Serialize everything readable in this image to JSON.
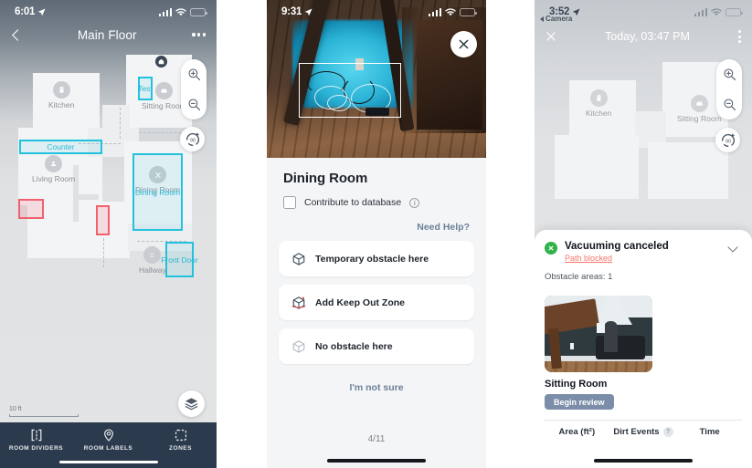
{
  "panel1": {
    "status": {
      "time": "6:01",
      "location_icon": "location-arrow-icon",
      "battery_icon": "battery-icon",
      "wifi_icon": "wifi-icon",
      "signal_icon": "cellular-bars-icon"
    },
    "nav": {
      "back_icon": "chevron-left-icon",
      "title": "Main Floor",
      "more_icon": "more-horizontal-icon"
    },
    "controls": {
      "zoom_in_icon": "zoom-in-icon",
      "zoom_out_icon": "zoom-out-icon",
      "rotate_label": "90",
      "rotate_icon": "rotate-90-icon",
      "layers_icon": "layers-icon"
    },
    "scale": {
      "label": "10 ft"
    },
    "map": {
      "rooms": [
        {
          "name": "Kitchen",
          "icon": "fridge-icon"
        },
        {
          "name": "Sitting Room",
          "icon": "sofa-icon"
        },
        {
          "name": "Living Room",
          "icon": "armchair-icon"
        },
        {
          "name": "Dining Room",
          "icon": "cutlery-icon"
        },
        {
          "name": "Hallway",
          "icon": "hallway-icon"
        }
      ],
      "zones": [
        {
          "name": "Test"
        },
        {
          "name": "Counter"
        },
        {
          "name": "Dining Room"
        },
        {
          "name": "Front Door"
        }
      ],
      "keep_out_zones": 2,
      "dock_icon": "dock-icon"
    },
    "tabs": [
      {
        "label": "ROOM DIVIDERS",
        "icon": "room-dividers-icon"
      },
      {
        "label": "ROOM LABELS",
        "icon": "map-pin-icon"
      },
      {
        "label": "ZONES",
        "icon": "dashed-square-icon"
      }
    ]
  },
  "panel2": {
    "status": {
      "time": "9:31",
      "location_icon": "location-arrow-icon",
      "battery_icon": "battery-icon",
      "wifi_icon": "wifi-icon",
      "signal_icon": "cellular-bars-icon"
    },
    "close_icon": "close-icon",
    "title": "Dining Room",
    "checkbox": {
      "label": "Contribute to database",
      "info_icon": "info-icon",
      "checked": false
    },
    "need_help": "Need Help?",
    "options": [
      {
        "label": "Temporary obstacle here",
        "icon": "cube-icon"
      },
      {
        "label": "Add Keep Out Zone",
        "icon": "cube-keepout-icon"
      },
      {
        "label": "No obstacle here",
        "icon": "cube-outline-icon"
      }
    ],
    "not_sure": "I'm not sure",
    "page_indicator": "4/11"
  },
  "panel3": {
    "status": {
      "time": "3:52",
      "location_icon": "location-arrow-icon",
      "battery_icon": "battery-low-icon",
      "wifi_icon": "wifi-icon",
      "signal_icon": "cellular-bars-icon",
      "back_app": "Camera"
    },
    "nav": {
      "close_icon": "close-icon",
      "title": "Today, 03:47 PM",
      "more_icon": "more-vertical-icon"
    },
    "controls": {
      "zoom_in_icon": "zoom-in-icon",
      "zoom_out_icon": "zoom-out-icon",
      "rotate_label": "90",
      "rotate_icon": "rotate-90-icon"
    },
    "map": {
      "rooms": [
        {
          "name": "Kitchen",
          "icon": "fridge-icon"
        },
        {
          "name": "Sitting Room",
          "icon": "sofa-icon"
        }
      ]
    },
    "sheet": {
      "status_icon": "canceled-icon",
      "status_title": "Vacuuming canceled",
      "status_reason": "Path blocked",
      "collapse_icon": "chevron-down-icon",
      "obstacle_areas_label": "Obstacle areas: 1",
      "obstacle_room": "Sitting Room",
      "begin_review": "Begin review",
      "stats": [
        {
          "label": "Area (ft²)",
          "has_info": false
        },
        {
          "label": "Dirt Events",
          "has_info": true
        },
        {
          "label": "Time",
          "has_info": false
        }
      ]
    }
  },
  "colors": {
    "accent_cyan": "#22c1dd",
    "keep_out_red": "#f2606e",
    "tabbar_navy": "#2c3a4d",
    "link_blue": "#6d8099",
    "status_green": "#2fb14a",
    "error_red": "#f2766b",
    "button_blue": "#7b8da8"
  }
}
